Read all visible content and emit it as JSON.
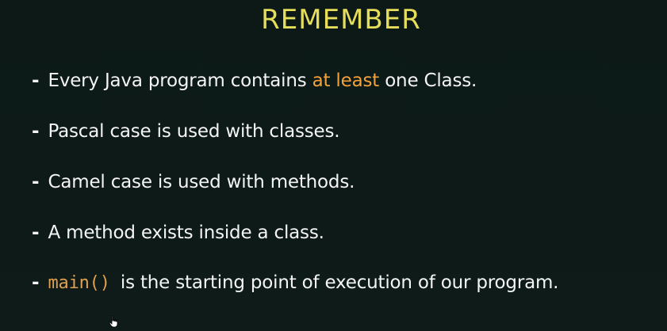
{
  "slide": {
    "title": "REMEMBER",
    "title_color": "#e6dd5a",
    "accent_color": "#f2a23c",
    "bullets": [
      {
        "dash": "-",
        "before": "Every Java program contains ",
        "highlight": "at least",
        "after": " one Class."
      },
      {
        "dash": "-",
        "text": "Pascal case is used with classes."
      },
      {
        "dash": "-",
        "text": "Camel case is used with methods."
      },
      {
        "dash": "-",
        "text": "A method exists inside a class."
      },
      {
        "dash": "-",
        "code": "main()",
        "after": " is the starting point of execution of our program."
      }
    ]
  },
  "cursor": {
    "icon": "hand-pointer-icon"
  }
}
